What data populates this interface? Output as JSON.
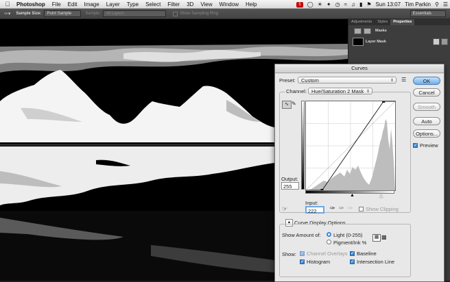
{
  "menubar": {
    "apple": "",
    "app_name": "Photoshop",
    "items": [
      "File",
      "Edit",
      "Image",
      "Layer",
      "Type",
      "Select",
      "Filter",
      "3D",
      "View",
      "Window",
      "Help"
    ],
    "badge": "5",
    "clock": "Sun 13:07",
    "user": "Tim Parkin"
  },
  "options_bar": {
    "sample_size_label": "Sample Size:",
    "sample_size_value": "Point Sample",
    "sample_label": "Sample:",
    "sample_value": "All Layers",
    "show_sampling_ring": "Show Sampling Ring",
    "workspace": "Essentials"
  },
  "panel": {
    "tabs": [
      "Adjustments",
      "Styles",
      "Properties"
    ],
    "active_tab": "Properties",
    "masks_label": "Masks",
    "layer_mask_label": "Layer Mask"
  },
  "dialog": {
    "title": "Curves",
    "preset_label": "Preset:",
    "preset_value": "Custom",
    "channel_label": "Channel:",
    "channel_value": "Hue/Saturation 2 Mask",
    "output_label": "Output:",
    "output_value": "255",
    "input_label": "Input:",
    "input_value": "222",
    "show_clipping": "Show Clipping",
    "show_clipping_checked": false,
    "curve_display_options": "Curve Display Options",
    "show_amount_label": "Show Amount of:",
    "light_option": "Light  (0-255)",
    "pigment_option": "Pigment/Ink %",
    "light_selected": true,
    "show_label": "Show:",
    "channel_overlays": "Channel Overlays",
    "baseline": "Baseline",
    "histogram": "Histogram",
    "intersection_line": "Intersection Line",
    "channel_overlays_checked": true,
    "baseline_checked": true,
    "histogram_checked": true,
    "intersection_line_checked": true,
    "buttons": {
      "ok": "OK",
      "cancel": "Cancel",
      "smooth": "Smooth",
      "auto": "Auto",
      "options": "Options..."
    },
    "preview_label": "Preview",
    "preview_checked": true,
    "curve_points": [
      {
        "input": 0,
        "output": 0
      },
      {
        "input": 46,
        "output": 0
      },
      {
        "input": 222,
        "output": 255
      },
      {
        "input": 255,
        "output": 255
      }
    ]
  }
}
